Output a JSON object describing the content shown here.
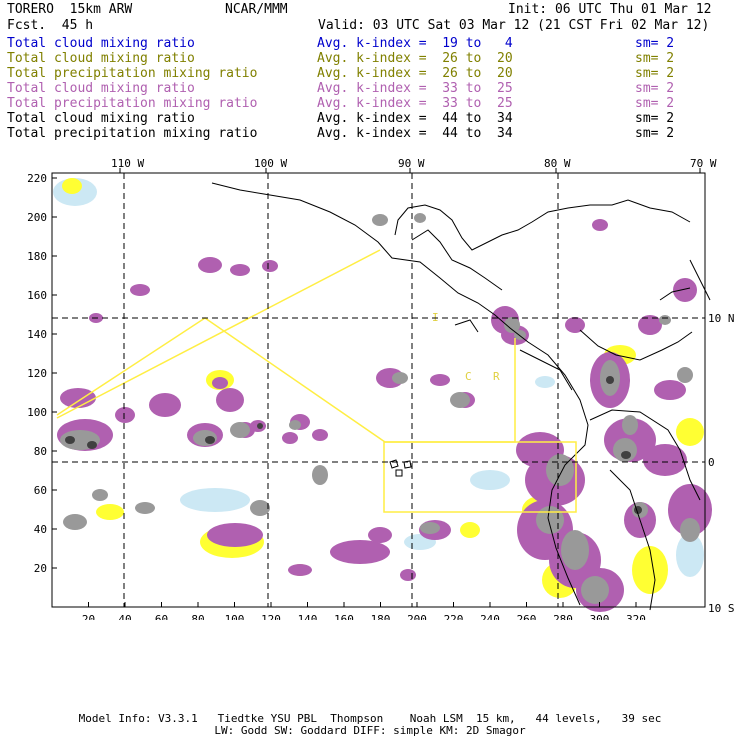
{
  "header": {
    "model": "TORERO  15km ARW",
    "org": "NCAR/MMM",
    "init": "Init: 06 UTC Thu 01 Mar 12",
    "fcst": "Fcst.  45 h",
    "valid": "Valid: 03 UTC Sat 03 Mar 12 (21 CST Fri 02 Mar 12)"
  },
  "legend_rows": [
    {
      "label": "Total cloud mixing ratio",
      "avg": "Avg. k-index =  19 to   4",
      "sm": "sm= 2",
      "color": "#0000cc"
    },
    {
      "label": "Total cloud mixing ratio",
      "avg": "Avg. k-index =  26 to  20",
      "sm": "sm= 2",
      "color": "#808000"
    },
    {
      "label": "Total precipitation mixing ratio",
      "avg": "Avg. k-index =  26 to  20",
      "sm": "sm= 2",
      "color": "#808000"
    },
    {
      "label": "Total cloud mixing ratio",
      "avg": "Avg. k-index =  33 to  25",
      "sm": "sm= 2",
      "color": "#b060b0"
    },
    {
      "label": "Total precipitation mixing ratio",
      "avg": "Avg. k-index =  33 to  25",
      "sm": "sm= 2",
      "color": "#b060b0"
    },
    {
      "label": "Total cloud mixing ratio",
      "avg": "Avg. k-index =  44 to  34",
      "sm": "sm= 2",
      "color": "#000000"
    },
    {
      "label": "Total precipitation mixing ratio",
      "avg": "Avg. k-index =  44 to  34",
      "sm": "sm= 2",
      "color": "#000000"
    }
  ],
  "map": {
    "lon_labels": [
      "110 W",
      "100 W",
      "90 W",
      "80 W",
      "70 W"
    ],
    "lat_labels": [
      "10 N",
      "0",
      "10 S"
    ],
    "x_ticks": [
      "20",
      "40",
      "60",
      "80",
      "100",
      "120",
      "140",
      "160",
      "180",
      "200",
      "220",
      "240",
      "260",
      "280",
      "300",
      "320"
    ],
    "y_ticks": [
      "20",
      "40",
      "60",
      "80",
      "100",
      "120",
      "140",
      "160",
      "180",
      "200",
      "220"
    ],
    "region_labels": [
      "I",
      "C",
      "R"
    ],
    "colors": {
      "purple": "#b060b0",
      "yellow": "#ffff33",
      "lightblue": "#cce8f4",
      "gray": "#999999",
      "dark": "#404040",
      "outline": "#ffee44"
    }
  },
  "footer": {
    "line1": "Model Info: V3.3.1   Tiedtke YSU PBL  Thompson    Noah LSM  15 km,   44 levels,   39 sec",
    "line2": "LW: Godd SW: Goddard DIFF: simple KM: 2D Smagor"
  }
}
